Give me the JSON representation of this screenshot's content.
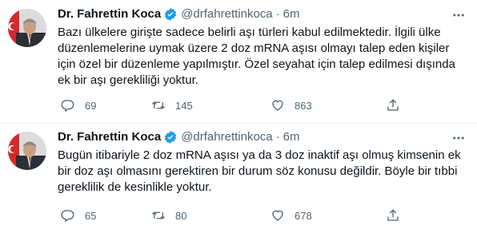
{
  "tweets": [
    {
      "author_name": "Dr. Fahrettin Koca",
      "handle": "@drfahrettinkoca",
      "separator": "·",
      "time": "6m",
      "text": "Bazı ülkelere girişte sadece belirli aşı türleri kabul edilmektedir. İlgili ülke düzenlemelerine uymak üzere 2 doz mRNA aşısı olmayı talep eden kişiler için özel bir düzenleme yapılmıştır. Özel seyahat için talep edilmesi dışında ek bir aşı gerekliliği yoktur.",
      "replies": "69",
      "retweets": "145",
      "likes": "863"
    },
    {
      "author_name": "Dr. Fahrettin Koca",
      "handle": "@drfahrettinkoca",
      "separator": "·",
      "time": "6m",
      "text": "Bugün itibariyle 2 doz mRNA aşısı ya da 3 doz inaktif aşı olmuş kimsenin ek bir doz aşı olmasını gerektiren bir durum söz konusu değildir. Böyle bir tıbbi gereklilik de kesinlikle yoktur.",
      "replies": "65",
      "retweets": "80",
      "likes": "678"
    }
  ],
  "icons": {
    "verified": "verified-badge-icon",
    "more": "more-options-icon",
    "reply": "reply-icon",
    "retweet": "retweet-icon",
    "like": "heart-icon",
    "share": "share-icon"
  },
  "colors": {
    "text": "#0f1419",
    "secondary": "#536471",
    "verified": "#1d9bf0",
    "divider": "#eff3f4",
    "avatar_red": "#d42a2a"
  }
}
